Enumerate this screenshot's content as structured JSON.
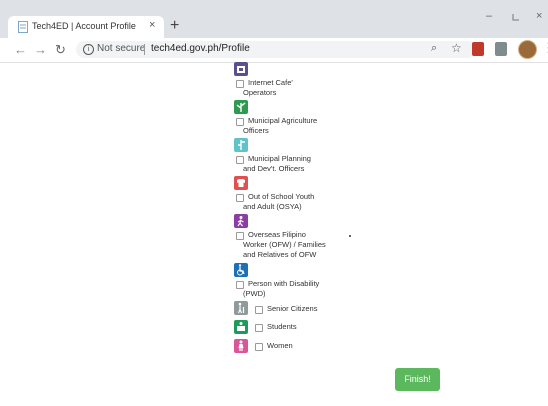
{
  "browser": {
    "tab_title": "Tech4ED | Account Profile",
    "tab_close": "×",
    "new_tab": "+",
    "security_label": "Not secure",
    "url": "tech4ed.gov.ph/Profile"
  },
  "categories": [
    {
      "label_1": "Internet Cafe'",
      "label_2": "Operators",
      "color": "#5a4f8f",
      "icon": "building-icon"
    },
    {
      "label_1": "Municipal Agriculture",
      "label_2": "Officers",
      "color": "#2e9a4f",
      "icon": "plant-icon"
    },
    {
      "label_1": "Municipal Planning",
      "label_2": "and Dev't. Officers",
      "color": "#5fc3c7",
      "icon": "planning-icon"
    },
    {
      "label_1": "Out of School Youth",
      "label_2": "and Adult (OSYA)",
      "color": "#e05050",
      "icon": "shirt-icon"
    },
    {
      "label_1": "Overseas Filipino",
      "label_2": "Worker (OFW) / Families",
      "label_3": "and Relatives of OFW",
      "color": "#8a3fa0",
      "icon": "traveler-icon"
    },
    {
      "label_1": "Person with Disability",
      "label_2": "(PWD)",
      "color": "#1e6fb8",
      "icon": "wheelchair-icon"
    },
    {
      "label_1": "Senior Citizens",
      "color": "#8e9a9b",
      "icon": "elderly-icon"
    },
    {
      "label_1": "Students",
      "color": "#1e9a5a",
      "icon": "student-icon"
    },
    {
      "label_1": "Women",
      "color": "#d9569b",
      "icon": "woman-icon"
    }
  ],
  "finish_label": "Finish!"
}
